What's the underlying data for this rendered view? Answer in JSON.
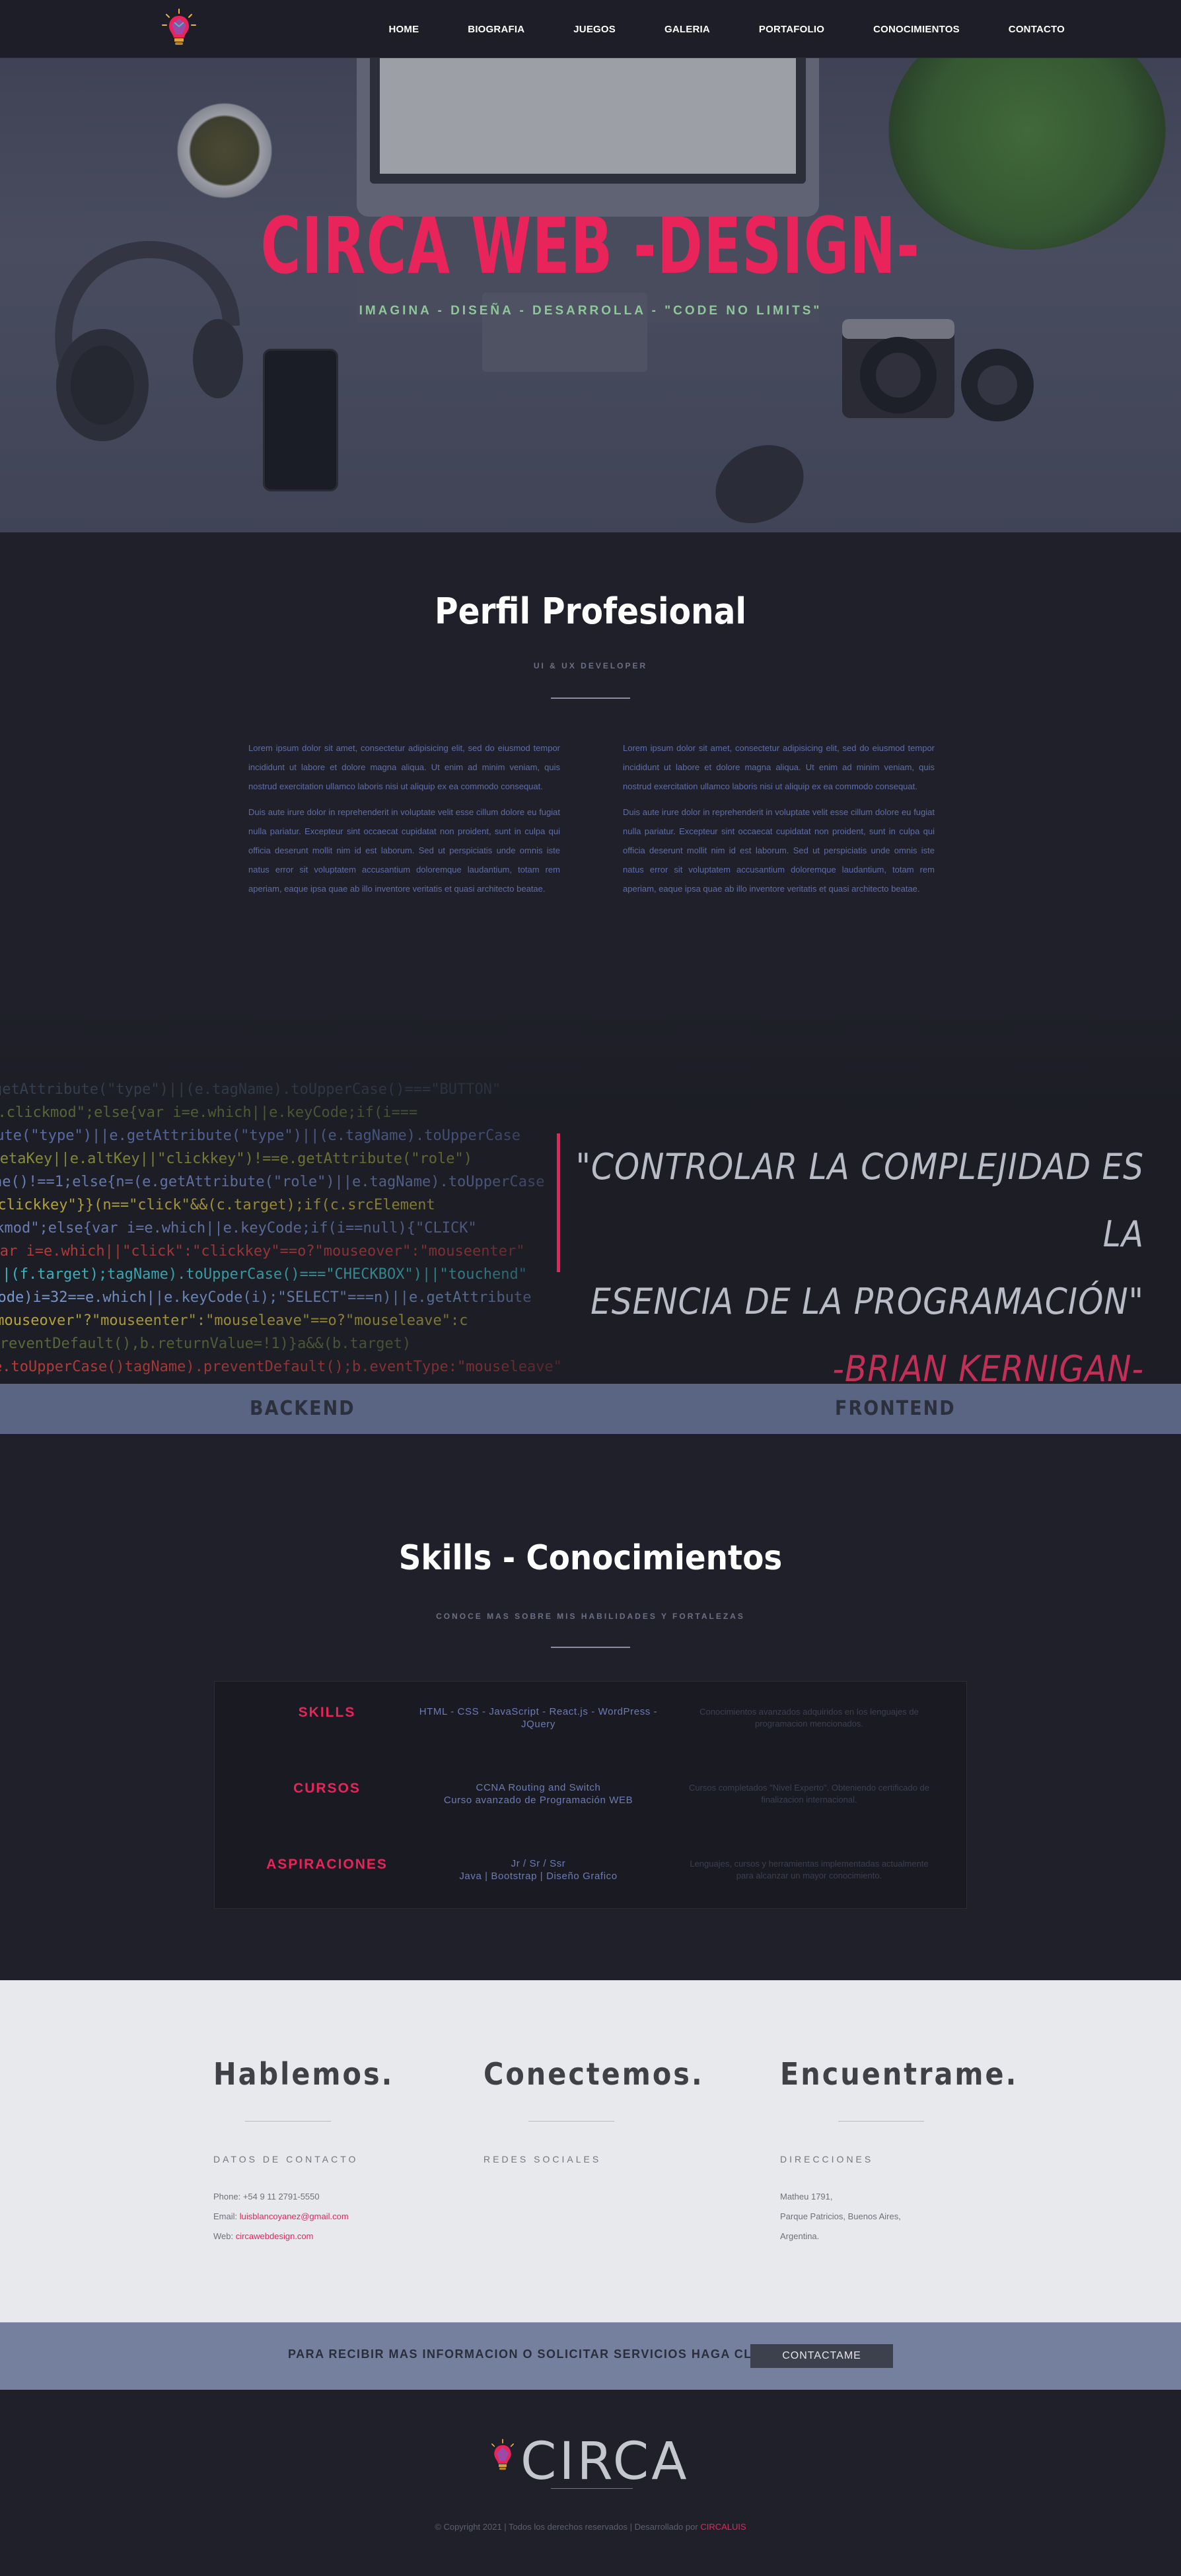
{
  "nav": {
    "logo_icon": "lightbulb-icon",
    "links": [
      "HOME",
      "BIOGRAFIA",
      "JUEGOS",
      "GALERIA",
      "PORTAFOLIO",
      "CONOCIMIENTOS",
      "CONTACTO"
    ]
  },
  "hero": {
    "title": "CIRCA WEB -DESIGN-",
    "subtitle": "IMAGINA - DISEÑA - DESARROLLA - \"CODE NO LIMITS\""
  },
  "perfil": {
    "title": "Perfil Profesional",
    "subtitle": "UI & UX DEVELOPER",
    "col1_p1": "Lorem ipsum dolor sit amet, consectetur adipisicing elit, sed do eiusmod tempor incididunt ut labore et dolore magna aliqua. Ut enim ad minim veniam, quis nostrud exercitation ullamco laboris nisi ut aliquip ex ea commodo consequat.",
    "col1_p2": "Duis aute irure dolor in reprehenderit in voluptate velit esse cillum dolore eu fugiat nulla pariatur. Excepteur sint occaecat cupidatat non proident, sunt in culpa qui officia deserunt mollit nim id est laborum. Sed ut perspiciatis unde omnis iste natus error sit voluptatem accusantium doloremque laudantium, totam rem aperiam, eaque ipsa quae ab illo inventore veritatis et quasi architecto beatae.",
    "col2_p1": "Lorem ipsum dolor sit amet, consectetur adipisicing elit, sed do eiusmod tempor incididunt ut labore et dolore magna aliqua. Ut enim ad minim veniam, quis nostrud exercitation ullamco laboris nisi ut aliquip ex ea commodo consequat.",
    "col2_p2": "Duis aute irure dolor in reprehenderit in voluptate velit esse cillum dolore eu fugiat nulla pariatur. Excepteur sint occaecat cupidatat non proident, sunt in culpa qui officia deserunt mollit nim id est laborum. Sed ut perspiciatis unde omnis iste natus error sit voluptatem accusantium doloremque laudantium, totam rem aperiam, eaque ipsa quae ab illo inventore veritatis et quasi architecto beatae."
  },
  "quote": {
    "line1": "\"CONTROLAR LA COMPLEJIDAD ES LA",
    "line2": "ESENCIA DE LA PROGRAMACIÓN\"",
    "author": "-BRIAN KERNIGAN-"
  },
  "bf_bar": {
    "left": "BACKEND",
    "right": "FRONTEND"
  },
  "skills": {
    "title": "Skills - Conocimientos",
    "subtitle": "CONOCE MAS SOBRE MIS HABILIDADES Y FORTALEZAS",
    "rows": [
      {
        "label": "SKILLS",
        "mid1": "HTML - CSS - JavaScript - React.js - WordPress -",
        "mid2": "JQuery",
        "desc1": "Conocimientos avanzados adquiridos en los lenguajes de",
        "desc2": "programacion mencionados."
      },
      {
        "label": "CURSOS",
        "mid1": "CCNA Routing and Switch",
        "mid2": "Curso avanzado de Programación WEB",
        "desc1": "Cursos completados \"Nivel Experto\". Obteniendo certificado de",
        "desc2": "finalizacion internacional."
      },
      {
        "label": "ASPIRACIONES",
        "mid1": "Jr / Sr / Ssr",
        "mid2": "Java | Bootstrap | Diseño Grafico",
        "desc1": "Lenguajes, cursos y herramientas implementadas actualmente",
        "desc2": "para alcanzar un mayor conocimiento."
      }
    ]
  },
  "contact": {
    "cols": [
      {
        "title": "Hablemos.",
        "subtitle": "DATOS DE CONTACTO",
        "line1_label": "Phone: ",
        "line1_value": "+54 9 11 2791-5550",
        "line2_label": "Email: ",
        "line2_value": "luisblancoyanez@gmail.com",
        "line3_label": "Web: ",
        "line3_value": "circawebdesign.com"
      },
      {
        "title": "Conectemos.",
        "subtitle": "REDES SOCIALES"
      },
      {
        "title": "Encuentrame.",
        "subtitle": "DIRECCIONES",
        "line1": "Matheu 1791,",
        "line2": "Parque Patricios, Buenos Aires,",
        "line3": "Argentina."
      }
    ]
  },
  "cta": {
    "text": "PARA RECIBIR MAS INFORMACION O SOLICITAR SERVICIOS HAGA CLICK AQUÍ",
    "button": "CONTACTAME"
  },
  "footer": {
    "logo": "CIRCA",
    "copy_prefix": "© Copyright 2021 | Todos los derechos reservados | Desarrollado por ",
    "copy_author": "CIRCALUIS"
  },
  "colors": {
    "accent": "#e8245a",
    "background": "#1f2029",
    "band": "#5a6584",
    "light": "#e8e9ec"
  }
}
